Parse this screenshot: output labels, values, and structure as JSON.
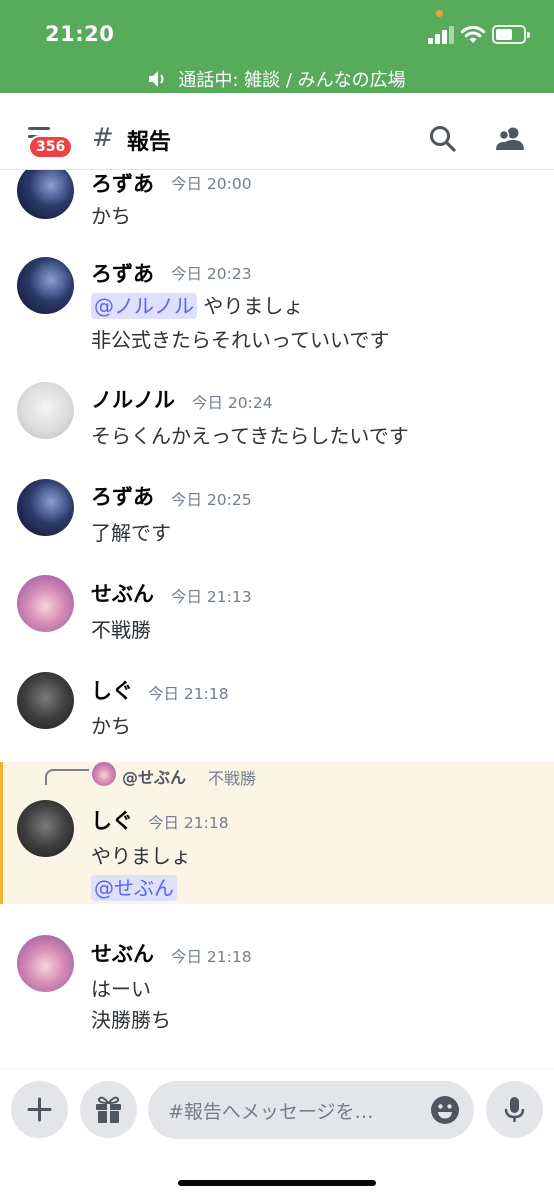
{
  "status_bar": {
    "time": "21:20",
    "call_text": "通話中: 雑談 / みんなの広場",
    "battery_level": 0.6
  },
  "header": {
    "badge_count": "356",
    "hash_symbol": "#",
    "channel_name": "報告"
  },
  "messages": [
    {
      "author": "ろずあ",
      "timestamp": "今日 20:00",
      "lines": [
        "かち"
      ]
    },
    {
      "author": "ろずあ",
      "timestamp": "今日 20:23",
      "mention": "@ノルノル",
      "lines": [
        "やりましょ",
        "非公式きたらそれいっていいです"
      ]
    },
    {
      "author": "ノルノル",
      "timestamp": "今日 20:24",
      "lines": [
        "そらくんかえってきたらしたいです"
      ]
    },
    {
      "author": "ろずあ",
      "timestamp": "今日 20:25",
      "lines": [
        "了解です"
      ]
    },
    {
      "author": "せぶん",
      "timestamp": "今日 21:13",
      "lines": [
        "不戦勝"
      ]
    },
    {
      "author": "しぐ",
      "timestamp": "今日 21:18",
      "lines": [
        "かち"
      ]
    },
    {
      "reply_to": {
        "author": "@せぶん",
        "text": "不戦勝"
      },
      "author": "しぐ",
      "timestamp": "今日 21:18",
      "lines": [
        "やりましょ"
      ],
      "mention": "@せぶん"
    },
    {
      "author": "せぶん",
      "timestamp": "今日 21:18",
      "lines": [
        "はーい",
        "決勝勝ち"
      ]
    }
  ],
  "input": {
    "placeholder": "#報告へメッセージを…"
  },
  "icons": {
    "menu": "hamburger-icon",
    "search": "search-icon",
    "members": "members-icon",
    "add": "plus-icon",
    "gift": "gift-icon",
    "emoji": "emoji-icon",
    "mic": "microphone-icon"
  },
  "colors": {
    "status_bar": "#58ab5b",
    "badge": "#ed4245",
    "mention_bg": "#dee0fc",
    "mention_text": "#5865f2",
    "highlight_bg": "#fbf5e6",
    "highlight_border": "#f0b132"
  }
}
